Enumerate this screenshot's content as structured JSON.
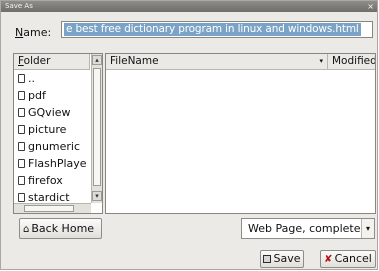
{
  "window": {
    "title": "Save As",
    "close_glyph": "×"
  },
  "name_field": {
    "label": "Name:",
    "value": "e best free dictionary program in linux and windows.html"
  },
  "folder_panel": {
    "header": "Folder",
    "items": [
      {
        "label": "..",
        "icon": "folder-icon"
      },
      {
        "label": "pdf",
        "icon": "folder-icon"
      },
      {
        "label": "GQview",
        "icon": "folder-icon"
      },
      {
        "label": "picture",
        "icon": "folder-icon"
      },
      {
        "label": "gnumeric",
        "icon": "folder-icon"
      },
      {
        "label": "FlashPlaye",
        "icon": "folder-icon"
      },
      {
        "label": "firefox",
        "icon": "folder-icon"
      },
      {
        "label": "stardict",
        "icon": "folder-icon"
      }
    ]
  },
  "file_panel": {
    "columns": [
      {
        "label": "FileName",
        "sort_glyph": "▾"
      },
      {
        "label": "Modified"
      }
    ]
  },
  "back_home": {
    "label": "Back Home",
    "icon": "home-icon"
  },
  "file_type": {
    "selected": "Web Page, complete",
    "arrow": "▾"
  },
  "buttons": {
    "save": "Save",
    "cancel": "Cancel",
    "cancel_glyph": "✘"
  },
  "colors": {
    "selection": "#7aa3c7",
    "titlebar": "#7e7c78",
    "window_bg": "#eceae6"
  }
}
